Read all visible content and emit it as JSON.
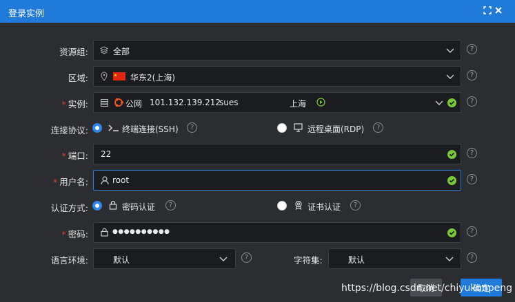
{
  "window": {
    "title": "登录实例"
  },
  "form": {
    "resource_group": {
      "label": "资源组:",
      "value": "全部"
    },
    "region": {
      "label": "区域:",
      "value": "华东2(上海)"
    },
    "instance": {
      "label": "实例:",
      "network": "公网",
      "ip": "101.132.139.212",
      "name": "sues",
      "location": "上海"
    },
    "protocol": {
      "label": "连接协议:",
      "options": [
        {
          "label": "终端连接(SSH)",
          "selected": true
        },
        {
          "label": "远程桌面(RDP)",
          "selected": false
        }
      ]
    },
    "port": {
      "label": "端口:",
      "value": "22"
    },
    "username": {
      "label": "用户名:",
      "value": "root"
    },
    "auth": {
      "label": "认证方式:",
      "options": [
        {
          "label": "密码认证",
          "selected": true
        },
        {
          "label": "证书认证",
          "selected": false
        }
      ]
    },
    "password": {
      "label": "密码:",
      "value": "●●●●●●●●●●"
    },
    "locale": {
      "label": "语言环境:",
      "value": "默认"
    },
    "charset": {
      "label": "字符集:",
      "value": "默认"
    },
    "help_glyph": "?"
  },
  "footer": {
    "cancel_label": "取消",
    "confirm_label": "确定",
    "watermark": "https://blog.csdn.net/chiyukunpeng"
  },
  "colors": {
    "titlebar": "#1f7ad9",
    "accent": "#2f86e8",
    "ok": "#7cc83d",
    "required": "#e23a3a"
  }
}
